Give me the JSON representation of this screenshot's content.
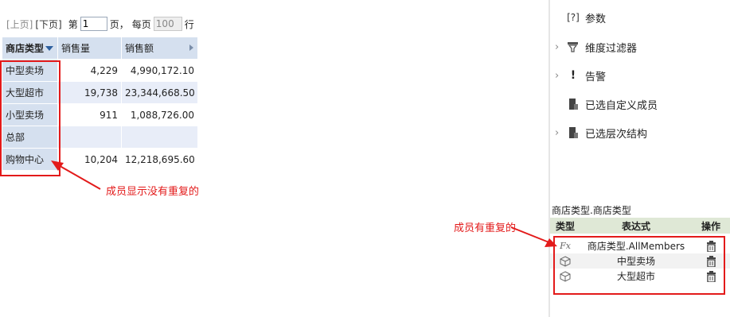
{
  "pager": {
    "prev": "[上页]",
    "next": "[下页]",
    "page_prefix": "第",
    "page_value": "1",
    "page_suffix": "页，",
    "per_page_prefix": "每页",
    "per_page_value": "100",
    "per_page_suffix": "行"
  },
  "table": {
    "headers": [
      "商店类型",
      "销售量",
      "销售额"
    ],
    "rows": [
      {
        "member": "中型卖场",
        "qty": "4,229",
        "amount": "4,990,172.10"
      },
      {
        "member": "大型超市",
        "qty": "19,738",
        "amount": "23,344,668.50"
      },
      {
        "member": "小型卖场",
        "qty": "911",
        "amount": "1,088,726.00"
      },
      {
        "member": "总部",
        "qty": "",
        "amount": ""
      },
      {
        "member": "购物中心",
        "qty": "10,204",
        "amount": "12,218,695.60"
      }
    ]
  },
  "annotations": {
    "left": "成员显示没有重复的",
    "right": "成员有重复的"
  },
  "panel": {
    "items": [
      {
        "label": "参数",
        "icon": "param-icon",
        "expandable": false
      },
      {
        "label": "维度过滤器",
        "icon": "filter-icon",
        "expandable": true
      },
      {
        "label": "告警",
        "icon": "alert-icon",
        "expandable": true
      },
      {
        "label": "已选自定义成员",
        "icon": "custom-member-icon",
        "expandable": false
      },
      {
        "label": "已选层次结构",
        "icon": "hierarchy-icon",
        "expandable": true
      }
    ],
    "caption": "商店类型.商店类型",
    "expr_table": {
      "headers": [
        "类型",
        "表达式",
        "操作"
      ],
      "rows": [
        {
          "type_icon": "fx-icon",
          "type_text": "Fx",
          "expr": "商店类型.AllMembers",
          "action": "delete-icon"
        },
        {
          "type_icon": "cube-icon",
          "expr": "中型卖场",
          "action": "delete-icon"
        },
        {
          "type_icon": "cube-icon",
          "expr": "大型超市",
          "action": "delete-icon"
        }
      ]
    }
  },
  "colors": {
    "accent_red": "#e31a1a",
    "header_blue": "#d5e0ef",
    "expr_header_green": "#dfe8d6"
  }
}
